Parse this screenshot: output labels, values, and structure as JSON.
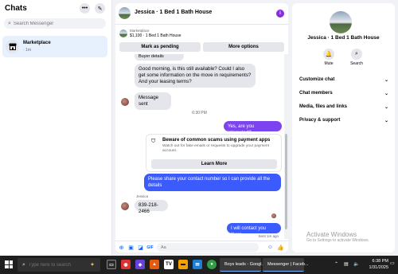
{
  "sidebar": {
    "title": "Chats",
    "search_placeholder": "Search Messenger",
    "conversations": [
      {
        "name": "Marketplace",
        "time": "· 1m"
      }
    ]
  },
  "chat": {
    "header_title": "Jessica · 1 Bed 1 Bath House",
    "listing_label": "Marketplace",
    "listing_sub": "$1,100 · 1 Bed 1 Bath House",
    "mark_pending_label": "Mark as pending",
    "more_options_label": "More options",
    "messages": {
      "buyer_details": "Buyer details",
      "inquiry": "Good morning, is this still available? Could I also get some information on the move in requirements? And your leasing terms?",
      "message_sent": "Message sent",
      "time_divider": "6:30 PM",
      "reply_yes": "Yes, are you interested?",
      "scam_title": "Beware of common scams using payment apps",
      "scam_body": "Watch out for fake emails or requests to upgrade your payment account.",
      "learn_more": "Learn More",
      "share_contact": "Please share your contact number so I can provide all the details",
      "sender_name": "Jessica",
      "phone": "839-218-2466",
      "will_contact": "I will contact you there",
      "sent_status": "Sent 1m ago"
    },
    "composer_placeholder": "Aa"
  },
  "panel": {
    "name": "Jessica · 1 Bed 1 Bath House",
    "mute_label": "Mute",
    "search_label": "Search",
    "rows": [
      "Customize chat",
      "Chat members",
      "Media, files and links",
      "Privacy & support"
    ]
  },
  "watermark": {
    "title": "Activate Windows",
    "subtitle": "Go to Settings to activate Windows."
  },
  "taskbar": {
    "search_placeholder": "Type here to search",
    "task_boys_leads": "Boys leads - Googl...",
    "task_messenger": "Messenger | Faceb...",
    "time": "6:38 PM",
    "date": "1/31/2025"
  },
  "colors": {
    "accent_purple": "#7b44f0",
    "accent_blue": "#3b5bfd",
    "messenger_blue": "#0866ff"
  }
}
